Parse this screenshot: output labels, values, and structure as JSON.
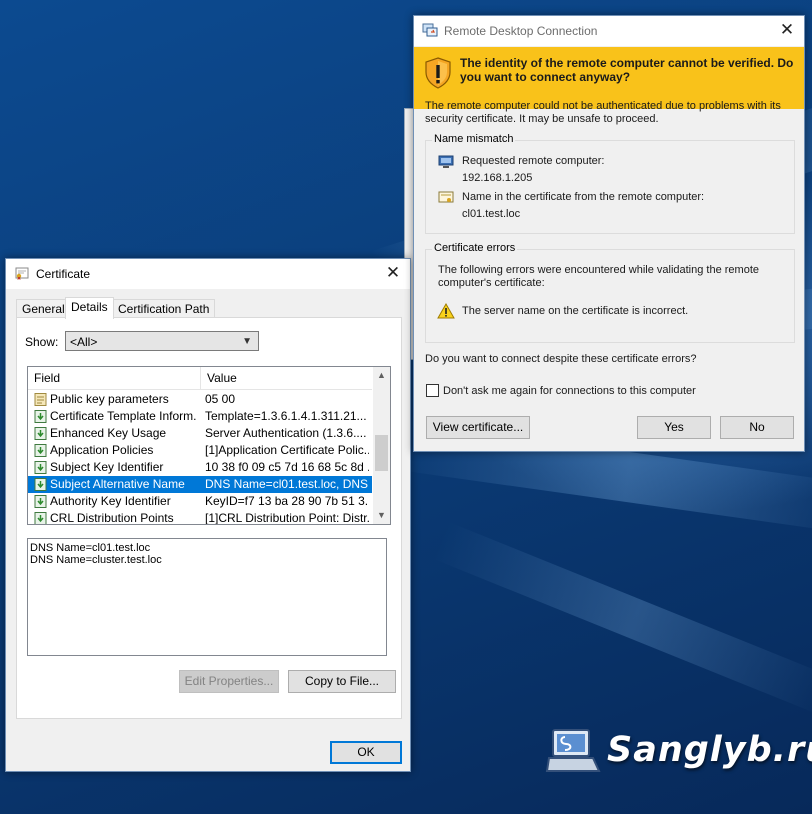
{
  "certificate": {
    "title": "Certificate",
    "tabs": [
      {
        "label": "General",
        "active": false
      },
      {
        "label": "Details",
        "active": true
      },
      {
        "label": "Certification Path",
        "active": false
      }
    ],
    "show_label": "Show:",
    "show_value": "<All>",
    "columns": {
      "field": "Field",
      "value": "Value"
    },
    "rows": [
      {
        "field": "Public key parameters",
        "value": "05 00",
        "icon": "certificate-doc-icon"
      },
      {
        "field": "Certificate Template Inform...",
        "value": "Template=1.3.6.1.4.1.311.21...",
        "icon": "download-doc-icon"
      },
      {
        "field": "Enhanced Key Usage",
        "value": "Server Authentication (1.3.6....",
        "icon": "download-doc-icon"
      },
      {
        "field": "Application Policies",
        "value": "[1]Application Certificate Polic...",
        "icon": "download-doc-icon"
      },
      {
        "field": "Subject Key Identifier",
        "value": "10 38 f0 09 c5 7d 16 68 5c 8d ...",
        "icon": "download-doc-icon"
      },
      {
        "field": "Subject Alternative Name",
        "value": "DNS Name=cl01.test.loc, DNS ...",
        "icon": "download-doc-icon",
        "selected": true
      },
      {
        "field": "Authority Key Identifier",
        "value": "KeyID=f7 13 ba 28 90 7b 51 3...",
        "icon": "download-doc-icon"
      },
      {
        "field": "CRL Distribution Points",
        "value": "[1]CRL Distribution Point: Distr...",
        "icon": "download-doc-icon"
      }
    ],
    "detail_lines": [
      "DNS Name=cl01.test.loc",
      "DNS Name=cluster.test.loc"
    ],
    "edit_properties": "Edit Properties...",
    "copy_to_file": "Copy to File...",
    "ok": "OK"
  },
  "rdp": {
    "title": "Remote Desktop Connection",
    "warning": "The identity of the remote computer cannot be verified. Do you want to connect anyway?",
    "intro": "The remote computer could not be authenticated due to problems with its security certificate. It may be unsafe to proceed.",
    "name_mismatch": {
      "label": "Name mismatch",
      "requested_label": "Requested remote computer:",
      "requested_value": "192.168.1.205",
      "cert_name_label": "Name in the certificate from the remote computer:",
      "cert_name_value": "cl01.test.loc"
    },
    "cert_errors": {
      "label": "Certificate errors",
      "desc": "The following errors were encountered while validating the remote computer's certificate:",
      "error": "The server name on the certificate is incorrect."
    },
    "question": "Do you want to connect despite these certificate errors?",
    "dont_ask": "Don't ask me again for connections to this computer",
    "view_certificate": "View certificate...",
    "yes": "Yes",
    "no": "No"
  },
  "watermark": "Sanglyb.ru",
  "colors": {
    "selection": "#0078d7",
    "warning_bar": "#f9c21a",
    "desktop": "#0b3f7c"
  }
}
